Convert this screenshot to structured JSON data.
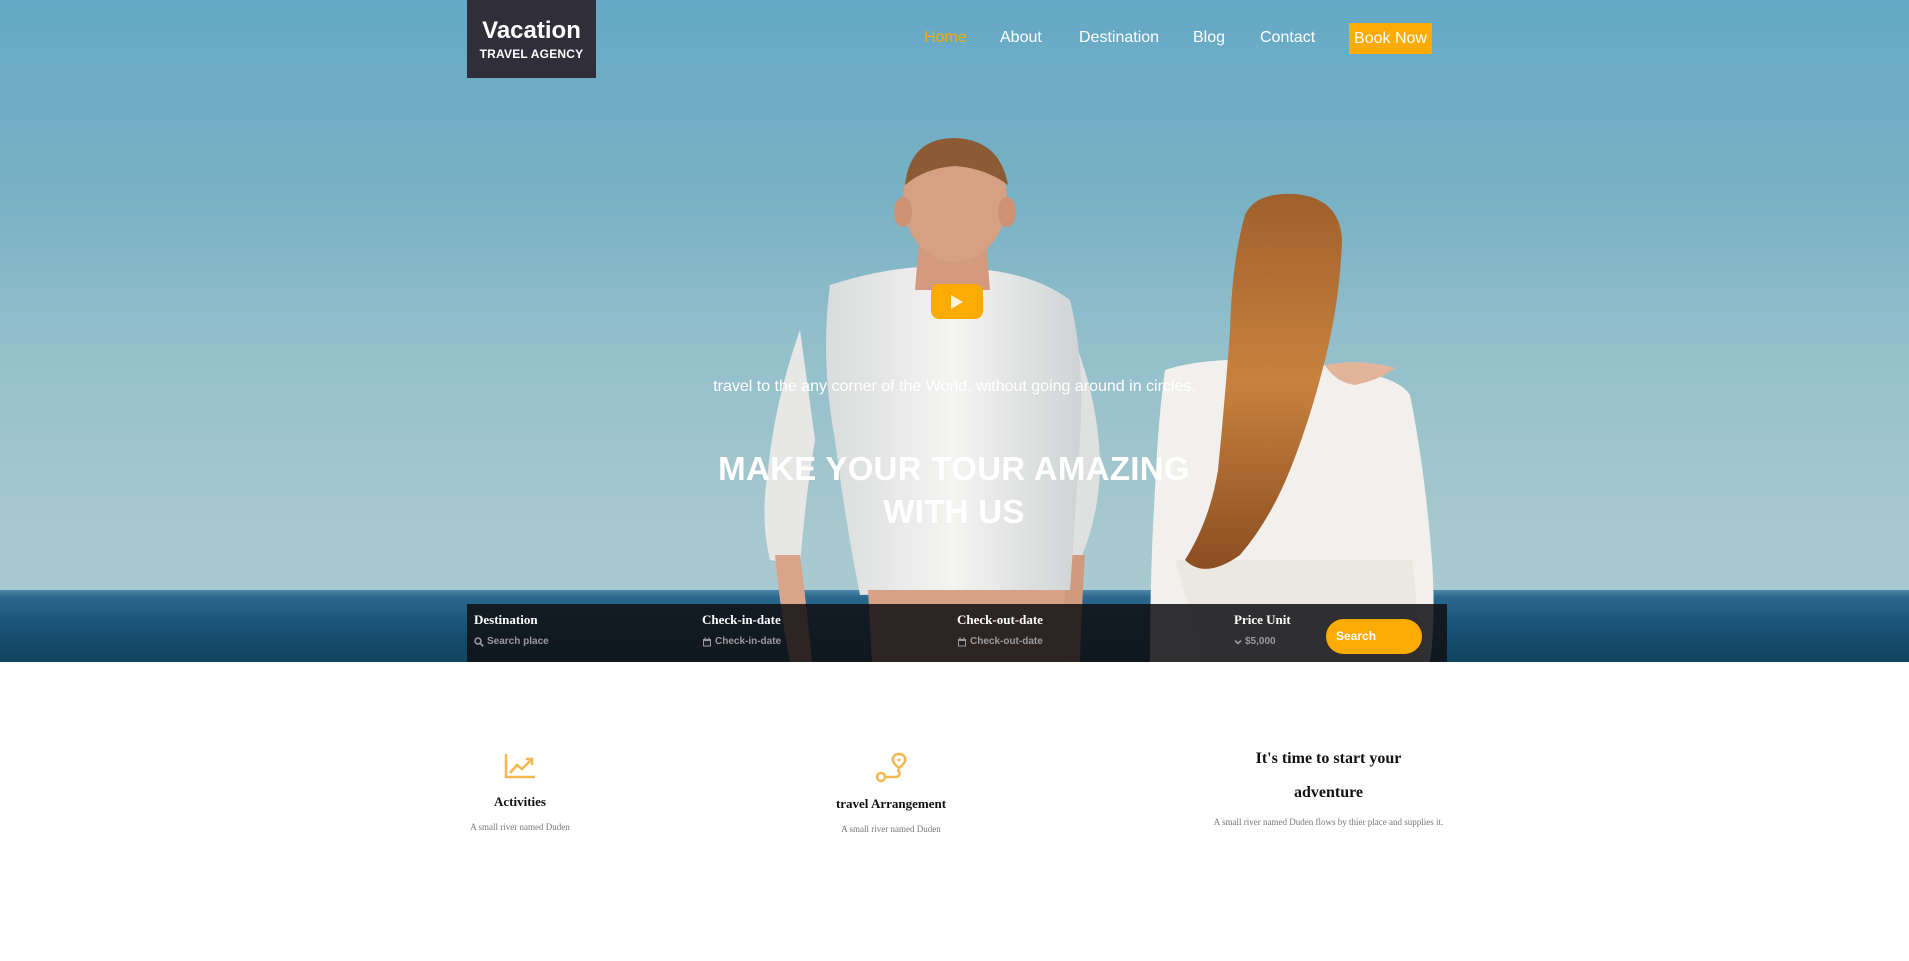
{
  "brand": {
    "title": "Vacation",
    "subtitle": "TRAVEL AGENCY"
  },
  "nav": {
    "items": [
      {
        "label": "Home",
        "active": true
      },
      {
        "label": "About",
        "active": false
      },
      {
        "label": "Destination",
        "active": false
      },
      {
        "label": "Blog",
        "active": false
      },
      {
        "label": "Contact",
        "active": false
      }
    ],
    "book_label": "Book Now"
  },
  "hero": {
    "play_icon": "play-icon",
    "tagline": "travel to the any corner of the World, without going around in circles.",
    "title_line1": "MAKE YOUR TOUR AMAZING",
    "title_line2": "WITH US"
  },
  "search": {
    "destination": {
      "label": "Destination",
      "placeholder": "Search place",
      "icon": "search-icon"
    },
    "checkin": {
      "label": "Check-in-date",
      "placeholder": "Check-in-date",
      "icon": "calendar-icon"
    },
    "checkout": {
      "label": "Check-out-date",
      "placeholder": "Check-out-date",
      "icon": "calendar-icon"
    },
    "price": {
      "label": "Price Unit",
      "value": "$5,000",
      "icon": "chevron-down-icon"
    },
    "button_label": "Search"
  },
  "features": [
    {
      "icon": "trending-chart-icon",
      "title": "Activities",
      "text": "A small river named Duden"
    },
    {
      "icon": "route-pin-icon",
      "title": "travel Arrangement",
      "text": "A small river named Duden"
    }
  ],
  "adventure": {
    "title_line1": "It's time to start your",
    "title_line2": "adventure",
    "text": "A small river named Duden flows by thier place and supplies it."
  },
  "colors": {
    "accent": "#fbab03",
    "logo_bg": "#302e3a",
    "search_bar_bg": "#101014",
    "sky": "#79b1c4",
    "sea": "#1d5a7f"
  }
}
